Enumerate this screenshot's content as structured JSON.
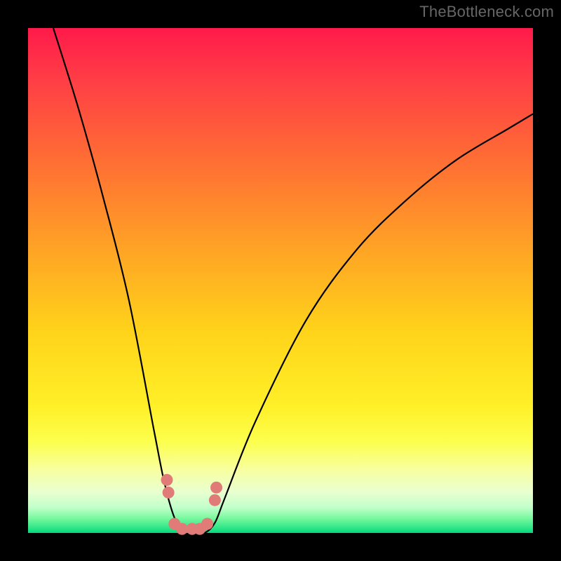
{
  "watermark": "TheBottleneck.com",
  "chart_data": {
    "type": "line",
    "title": "",
    "xlabel": "",
    "ylabel": "",
    "ylim": [
      0,
      100
    ],
    "xlim": [
      0,
      100
    ],
    "series": [
      {
        "name": "bottleneck-curve",
        "x": [
          5,
          10,
          15,
          20,
          25,
          27,
          29,
          31,
          33,
          35,
          37,
          39,
          45,
          55,
          65,
          75,
          85,
          95,
          100
        ],
        "values": [
          100,
          84,
          66,
          46,
          20,
          10,
          3,
          0,
          0,
          0,
          2,
          7,
          22,
          42,
          56,
          66,
          74,
          80,
          83
        ]
      }
    ],
    "markers": {
      "name": "highlight-dots",
      "x": [
        27.5,
        27.8,
        29.0,
        30.5,
        32.5,
        34.0,
        35.5,
        37.0,
        37.3
      ],
      "values": [
        10.5,
        8.0,
        1.8,
        0.8,
        0.8,
        0.8,
        1.8,
        6.5,
        9.0
      ]
    },
    "annotations": [],
    "legend": null,
    "grid": false
  },
  "colors": {
    "curve": "#000000",
    "marker": "#e07b78"
  }
}
